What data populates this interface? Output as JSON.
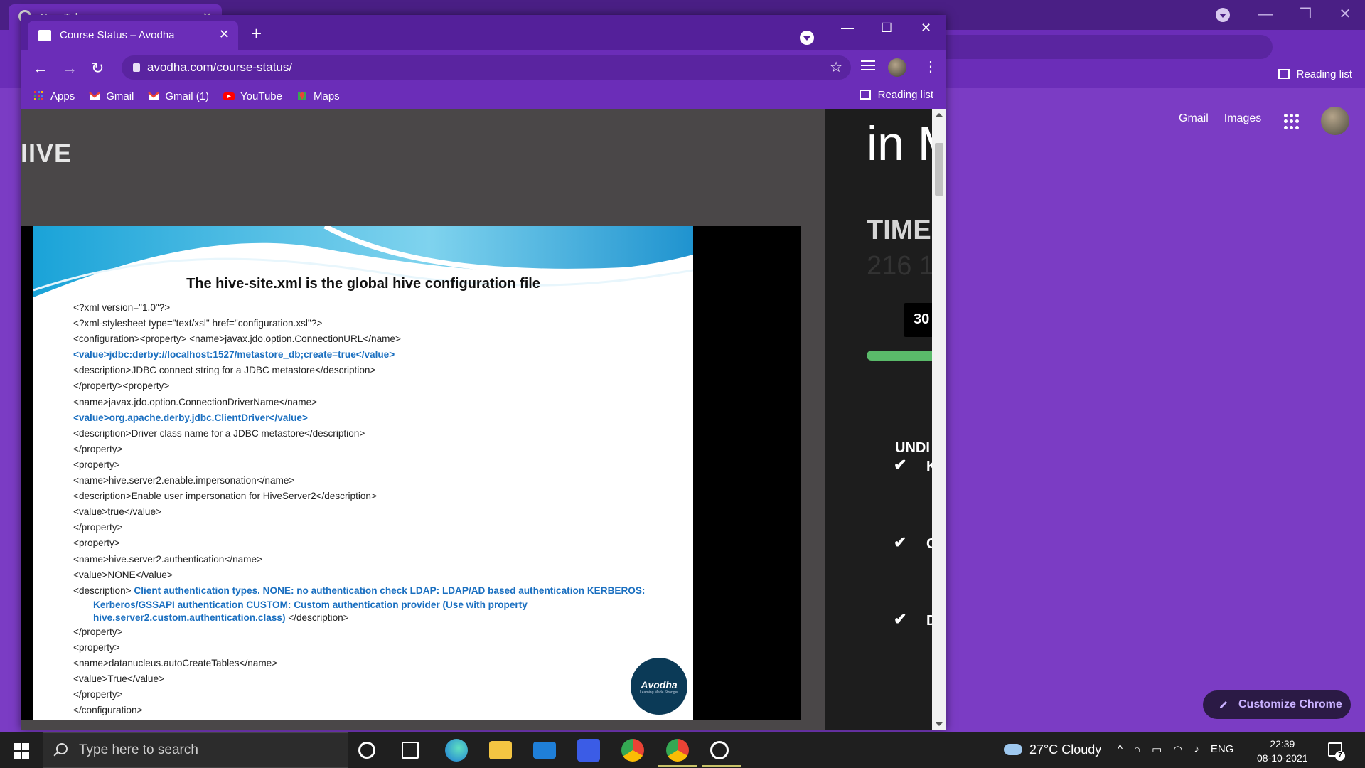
{
  "background_window": {
    "tab_title": "New Tab",
    "reading_list_label": "Reading list",
    "links": [
      "Gmail",
      "Images"
    ],
    "customize_label": "Customize Chrome"
  },
  "window": {
    "tab_title": "Course Status – Avodha",
    "url": "avodha.com/course-status/",
    "bookmarks": [
      {
        "label": "Apps",
        "icon": "apps-grid-icon"
      },
      {
        "label": "Gmail",
        "icon": "gmail-icon"
      },
      {
        "label": "Gmail (1)",
        "icon": "gmail-icon"
      },
      {
        "label": "YouTube",
        "icon": "youtube-icon"
      },
      {
        "label": "Maps",
        "icon": "maps-icon"
      }
    ],
    "reading_list_label": "Reading list"
  },
  "page": {
    "heading": "IIVE",
    "slide": {
      "title": "The hive-site.xml is the global hive configuration file",
      "lines": [
        "<?xml version=\"1.0\"?>",
        "<?xml-stylesheet type=\"text/xsl\" href=\"configuration.xsl\"?>",
        "<configuration><property> <name>javax.jdo.option.ConnectionURL</name>",
        "<value>jdbc:derby://localhost:1527/metastore_db;create=true</value>",
        "<description>JDBC connect string for a JDBC metastore</description>",
        "</property><property>",
        "<name>javax.jdo.option.ConnectionDriverName</name>",
        "<value>org.apache.derby.jdbc.ClientDriver</value>",
        "<description>Driver class name for a JDBC  metastore</description>",
        "</property>",
        "<property>",
        "<name>hive.server2.enable.impersonation</name>",
        "<description>Enable user impersonation for HiveServer2</description>",
        "<value>true</value>",
        "</property>",
        "<property>",
        "<name>hive.server2.authentication</name>",
        "<value>NONE</value>"
      ],
      "desc_open": "<description>",
      "desc_hl_1": "Client authentication types. NONE: no authentication check LDAP: LDAP/AD based authentication KERBEROS:",
      "desc_hl_2": "Kerberos/GSSAPI authentication CUSTOM: Custom authentication provider (Use with property",
      "desc_hl_3": "hive.server2.custom.authentication.class)",
      "desc_close": " </description>",
      "lines_after": [
        "</property>",
        "<property>",
        "<name>datanucleus.autoCreateTables</name>",
        "<value>True</value>",
        "</property>",
        "</configuration>"
      ],
      "logo_text": "Avodha",
      "logo_tagline": "Learning Made Stronger"
    },
    "right_pane": {
      "title": "in M",
      "time_label": "TIME",
      "time_value": "216 1",
      "badge": "30",
      "progress_fraction": 1.0,
      "under_label": "UNDI",
      "check_letters": [
        "K",
        "C",
        "D"
      ]
    }
  },
  "taskbar": {
    "search_placeholder": "Type here to search",
    "weather": "27°C  Cloudy",
    "language": "ENG",
    "time": "22:39",
    "date": "08-10-2021",
    "notification_count": "7"
  },
  "colors": {
    "chrome_purple": "#6b2db8",
    "slide_highlight": "#1a6fc0",
    "progress_green": "#5aba6a"
  }
}
